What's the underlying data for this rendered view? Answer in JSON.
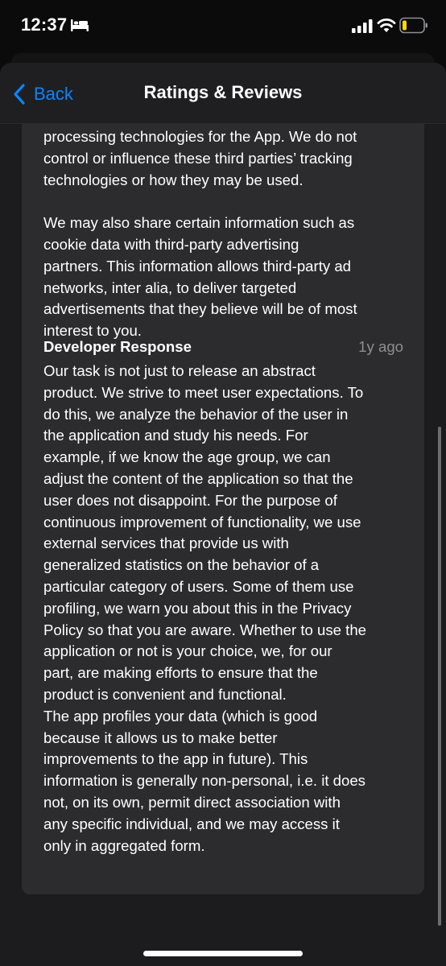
{
  "status_bar": {
    "time": "12:37",
    "icons": [
      "bed-icon",
      "signal-icon",
      "wifi-icon",
      "battery-icon"
    ],
    "battery_color": "#ffd60a"
  },
  "nav": {
    "back_label": "Back",
    "title": "Ratings & Reviews"
  },
  "review": {
    "text": "processing technologies for the App. We do not\ncontrol or influence these third parties’ tracking\ntechnologies or how they may be used.\n\nWe may also share certain information such as\ncookie data with third-party advertising\npartners. This information allows third-party ad\nnetworks, inter alia, to deliver targeted\nadvertisements that they believe will be of most\ninterest to you."
  },
  "developer_response": {
    "title": "Developer Response",
    "date": "1y ago",
    "text": "Our task is not just to release an abstract\nproduct. We strive to meet user expectations. To\ndo this, we analyze the behavior of the user in\nthe application and study his needs. For\nexample, if we know the age group, we can\nadjust the content of the application so that the\nuser does not disappoint. For the purpose of\ncontinuous improvement of functionality, we use\nexternal services that provide us with\ngeneralized statistics on the behavior of a\nparticular category of users. Some of them use\nprofiling, we warn you about this in the Privacy\nPolicy so that you are aware. Whether to use the\napplication or not is your choice, we, for our\npart, are making efforts to ensure that the\nproduct is convenient and functional.\nThe app profiles your data (which is good\nbecause it allows us to make better\nimprovements to the app in future). This\ninformation is generally non-personal, i.e. it does\nnot, on its own, permit direct association with\nany specific individual, and we may access it\nonly in aggregated form."
  },
  "colors": {
    "accent": "#0a84ff",
    "background": "#1c1c1e",
    "card": "#2c2c2e",
    "secondary_text": "#8e8e93"
  }
}
